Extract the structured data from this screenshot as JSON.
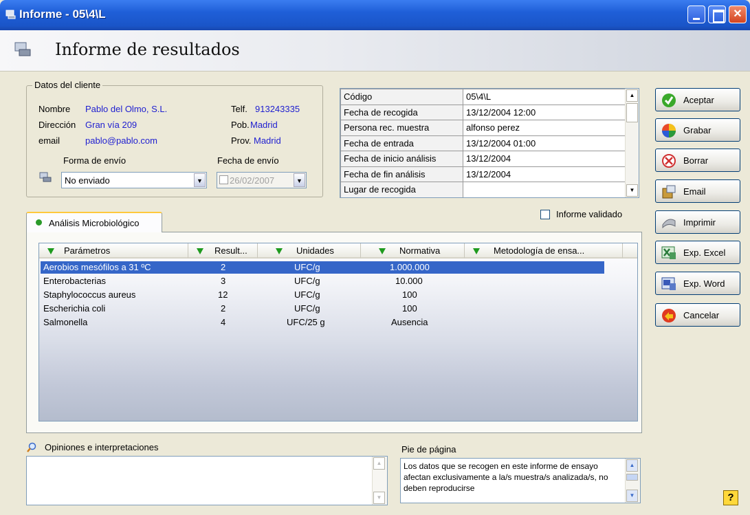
{
  "window": {
    "title": "Informe - 05\\4\\L"
  },
  "header": {
    "title": "Informe de resultados"
  },
  "client": {
    "legend": "Datos del cliente",
    "name_label": "Nombre",
    "name_value": "Pablo del Olmo, S.L.",
    "address_label": "Dirección",
    "address_value": "Gran vía 209",
    "email_label": "email",
    "email_value": "pablo@pablo.com",
    "phone_label": "Telf.",
    "phone_value": "913243335",
    "town_label": "Pob.",
    "town_value": "Madrid",
    "province_label": "Prov.",
    "province_value": "Madrid",
    "shipping_method_label": "Forma de envío",
    "shipping_method_value": "No enviado",
    "shipping_date_label": "Fecha de envío",
    "shipping_date_value": "26/02/2007"
  },
  "info_grid": [
    {
      "key": "Código",
      "value": "05\\4\\L"
    },
    {
      "key": "Fecha de recogida",
      "value": "13/12/2004 12:00"
    },
    {
      "key": "Persona rec. muestra",
      "value": "alfonso perez"
    },
    {
      "key": "Fecha de entrada",
      "value": "13/12/2004 01:00"
    },
    {
      "key": "Fecha de inicio análisis",
      "value": "13/12/2004"
    },
    {
      "key": "Fecha de fin análisis",
      "value": "13/12/2004"
    },
    {
      "key": "Lugar de recogida",
      "value": ""
    }
  ],
  "validated_label": "Informe validado",
  "tabs": [
    {
      "label": "Análisis Microbiológico"
    }
  ],
  "table": {
    "columns": [
      "Parámetros",
      "Result...",
      "Unidades",
      "Normativa",
      "Metodología de ensa..."
    ],
    "rows": [
      [
        "Aerobios mesófilos a 31 ºC",
        "2",
        "UFC/g",
        "1.000.000",
        ""
      ],
      [
        "Enterobacterias",
        "3",
        "UFC/g",
        "10.000",
        ""
      ],
      [
        "Staphylococcus aureus",
        "12",
        "UFC/g",
        "100",
        ""
      ],
      [
        "Escherichia coli",
        "2",
        "UFC/g",
        "100",
        ""
      ],
      [
        "Salmonella",
        "4",
        "UFC/25 g",
        "Ausencia",
        ""
      ]
    ]
  },
  "buttons": {
    "accept": "Aceptar",
    "save": "Grabar",
    "delete": "Borrar",
    "email": "Email",
    "print": "Imprimir",
    "excel": "Exp. Excel",
    "word": "Exp. Word",
    "cancel": "Cancelar"
  },
  "opinions": {
    "label": "Opiniones e interpretaciones",
    "value": ""
  },
  "footer": {
    "label": "Pie de página",
    "value": "Los datos que se recogen en este informe de ensayo afectan exclusivamente a la/s muestra/s analizada/s, no deben reproducirse"
  },
  "help_label": "?",
  "colors": {
    "titlebar": "#1f5fd8",
    "link_text": "#2020d0",
    "selection": "#3566c8",
    "tab_accent": "#ffc83c"
  }
}
